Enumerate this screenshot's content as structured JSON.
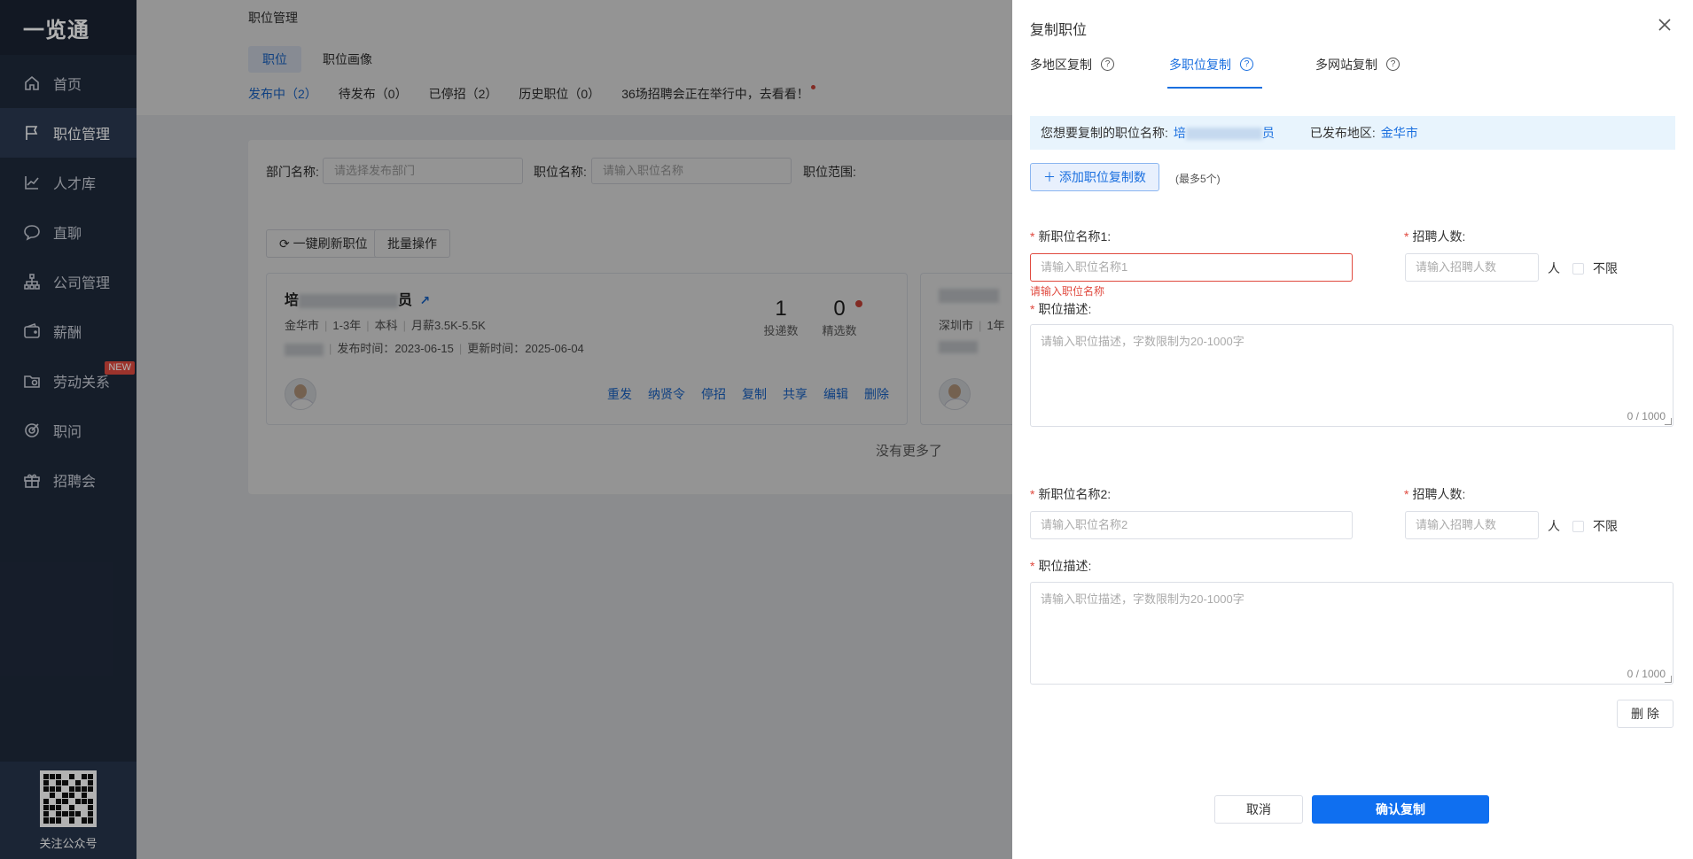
{
  "app": {
    "logo": "一览通"
  },
  "sidebar": {
    "items": [
      {
        "label": "首页",
        "icon": "home-icon"
      },
      {
        "label": "职位管理",
        "icon": "flag-icon",
        "active": true
      },
      {
        "label": "人才库",
        "icon": "chart-icon"
      },
      {
        "label": "直聊",
        "icon": "chat-icon"
      },
      {
        "label": "公司管理",
        "icon": "org-icon"
      },
      {
        "label": "薪酬",
        "icon": "wallet-icon"
      },
      {
        "label": "劳动关系",
        "icon": "folder-icon",
        "badge": "NEW"
      },
      {
        "label": "职问",
        "icon": "target-icon"
      },
      {
        "label": "招聘会",
        "icon": "gift-icon"
      }
    ],
    "qr_label": "关注公众号"
  },
  "page": {
    "title": "职位管理",
    "subtabs": [
      "职位",
      "职位画像"
    ],
    "status_tabs": [
      "发布中（2）",
      "待发布（0）",
      "已停招（2）",
      "历史职位（0）",
      "36场招聘会正在举行中，去看看！"
    ],
    "filters": {
      "dept_label": "部门名称:",
      "dept_placeholder": "请选择发布部门",
      "job_label": "职位名称:",
      "job_placeholder": "请输入职位名称",
      "range_label": "职位范围:"
    },
    "refresh_btn": "一键刷新职位",
    "batch_btn": "批量操作",
    "job_card": {
      "title_prefix": "培",
      "title_suffix": "员",
      "city": "金华市",
      "exp": "1-3年",
      "edu": "本科",
      "salary": "月薪3.5K-5.5K",
      "publish_time": "发布时间：2023-06-15",
      "update_time": "更新时间：2025-06-04",
      "delivered_num": "1",
      "delivered_label": "投递数",
      "selected_num": "0",
      "selected_label": "精选数",
      "actions": [
        "重发",
        "纳贤令",
        "停招",
        "复制",
        "共享",
        "编辑",
        "删除"
      ]
    },
    "job_card2": {
      "city": "深圳市",
      "exp": "1年"
    },
    "no_more": "没有更多了"
  },
  "drawer": {
    "title": "复制职位",
    "tabs": [
      "多地区复制",
      "多职位复制",
      "多网站复制"
    ],
    "info": {
      "name_label": "您想要复制的职位名称:",
      "name_value_prefix": "培",
      "name_value_suffix": "员",
      "region_label": "已发布地区:",
      "region_value": "金华市"
    },
    "add_btn": "添加职位复制数",
    "add_hint": "(最多5个)",
    "forms": [
      {
        "name_label": "新职位名称1:",
        "name_placeholder": "请输入职位名称1",
        "name_error": "请输入职位名称",
        "count_label": "招聘人数:",
        "count_placeholder": "请输入招聘人数",
        "unit": "人",
        "unlimited": "不限",
        "desc_label": "职位描述:",
        "desc_placeholder": "请输入职位描述，字数限制为20-1000字",
        "counter": "0 / 1000"
      },
      {
        "name_label": "新职位名称2:",
        "name_placeholder": "请输入职位名称2",
        "count_label": "招聘人数:",
        "count_placeholder": "请输入招聘人数",
        "unit": "人",
        "unlimited": "不限",
        "desc_label": "职位描述:",
        "desc_placeholder": "请输入职位描述，字数限制为20-1000字",
        "counter": "0 / 1000"
      }
    ],
    "delete_btn": "删 除",
    "cancel_btn": "取消",
    "confirm_btn": "确认复制"
  }
}
